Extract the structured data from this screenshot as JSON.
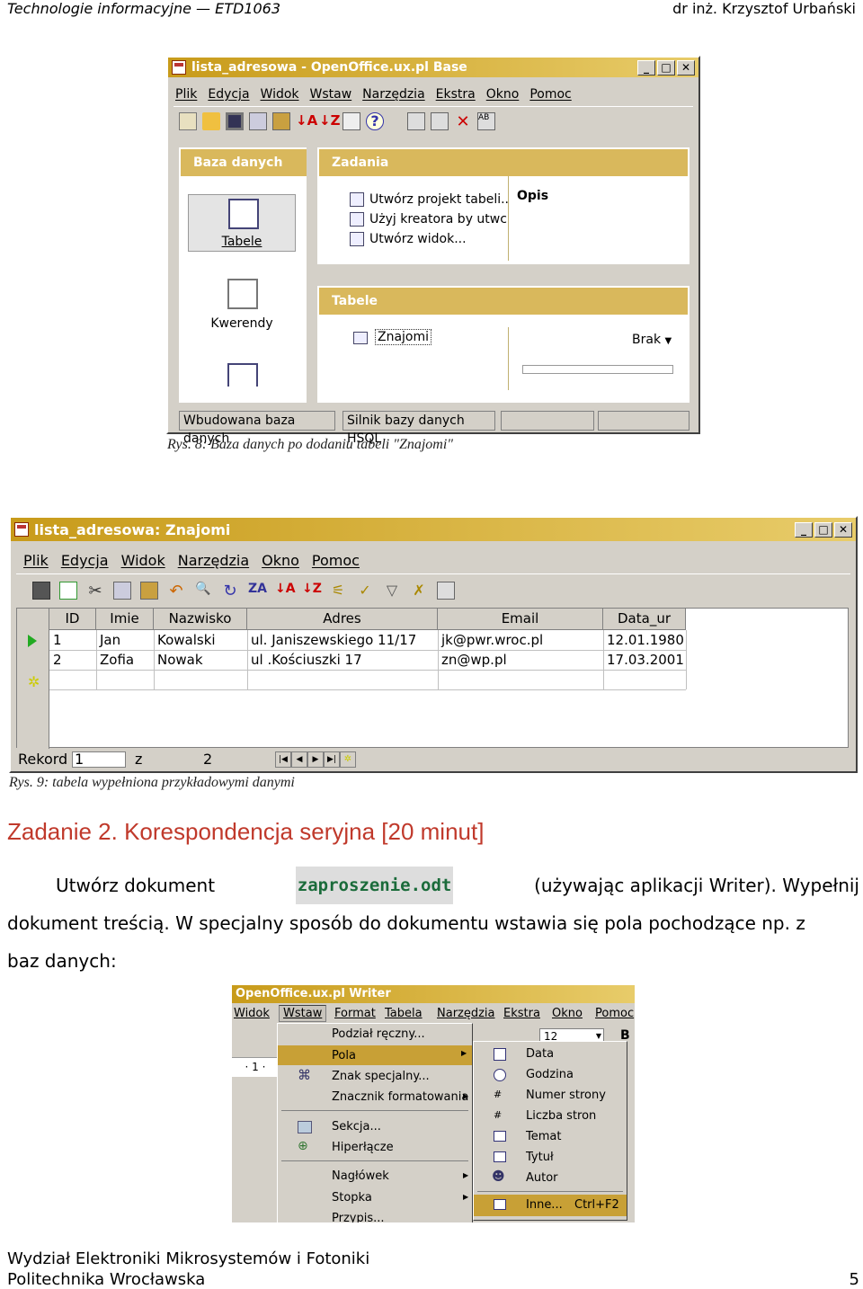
{
  "header": {
    "left": "Technologie informacyjne — ETD1063",
    "right": "dr inż. Krzysztof Urbański"
  },
  "fig1": {
    "title": "lista_adresowa - OpenOffice.ux.pl Base",
    "menu": [
      "Plik",
      "Edycja",
      "Widok",
      "Wstaw",
      "Narzędzia",
      "Ekstra",
      "Okno",
      "Pomoc"
    ],
    "left_header": "Baza danych",
    "left_items": [
      "Tabele",
      "Kwerendy"
    ],
    "tasks_header": "Zadania",
    "tasks": [
      "Utwórz projekt tabeli..",
      "Użyj kreatora by utwc",
      "Utwórz widok..."
    ],
    "opis_label": "Opis",
    "tables_header": "Tabele",
    "table_item": "Znajomi",
    "brak": "Brak",
    "status": [
      "Wbudowana baza danych",
      "Silnik bazy danych HSQL"
    ],
    "caption": "Rys. 8: Baza danych po dodaniu tabeli \"Znajomi\""
  },
  "fig2": {
    "title": "lista_adresowa: Znajomi",
    "menu": [
      "Plik",
      "Edycja",
      "Widok",
      "Narzędzia",
      "Okno",
      "Pomoc"
    ],
    "columns": [
      "ID",
      "Imie",
      "Nazwisko",
      "Adres",
      "Email",
      "Data_ur"
    ],
    "rows": [
      [
        "1",
        "Jan",
        "Kowalski",
        "ul. Janiszewskiego 11/17",
        "jk@pwr.wroc.pl",
        "12.01.1980"
      ],
      [
        "2",
        "Zofia",
        "Nowak",
        "ul .Kościuszki 17",
        "zn@wp.pl",
        "17.03.2001"
      ]
    ],
    "nav_rekord": "Rekord",
    "nav_current": "1",
    "nav_z": "z",
    "nav_total": "2",
    "caption": "Rys. 9: tabela wypełniona przykładowymi danymi"
  },
  "task": {
    "heading": "Zadanie 2. Korespondencja seryjna [20 minut]",
    "p1": "Utwórz dokument",
    "code": "zaproszenie.odt",
    "p2": "(używając aplikacji Writer). Wypełnij",
    "line2": "dokument treścią. W specjalny sposób do dokumentu wstawia się pola pochodzące np. z",
    "line3": "baz danych:"
  },
  "fig3": {
    "title": "OpenOffice.ux.pl Writer",
    "menu": [
      "Widok",
      "Wstaw",
      "Format",
      "Tabela",
      "Narzędzia",
      "Ekstra",
      "Okno",
      "Pomoc"
    ],
    "font_size": "12",
    "ruler": "· 1 ·",
    "wstaw_items": [
      "Podział ręczny...",
      "Pola",
      "Znak specjalny...",
      "Znacznik formatowania",
      "Sekcja...",
      "Hiperłącze",
      "Nagłówek",
      "Stopka",
      "Przypis..."
    ],
    "pola_items": [
      "Data",
      "Godzina",
      "Numer strony",
      "Liczba stron",
      "Temat",
      "Tytuł",
      "Autor",
      "Inne..."
    ],
    "shortcut": "Ctrl+F2"
  },
  "footer": {
    "line1": "Wydział Elektroniki Mikrosystemów i Fotoniki",
    "line2": "Politechnika Wrocławska",
    "page": "5"
  },
  "colors": {
    "accent_heading": "#c0392b",
    "title_gold": "#d9b85c",
    "menu_highlight": "#c8a036"
  }
}
